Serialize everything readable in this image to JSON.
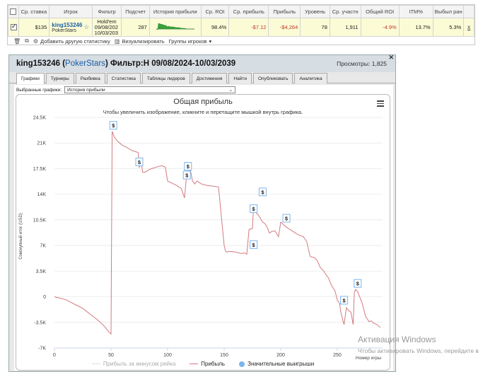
{
  "stats_table": {
    "headers": [
      "",
      "Ср. ставка",
      "Игрок",
      "Фильтр",
      "Подсчет",
      "История прибыли",
      "Ср. ROI",
      "Ср. прибыль",
      "Прибыль",
      "Уровень",
      "Ср. участн",
      "Общий ROI",
      "ITM%",
      "Выбыл ран",
      ""
    ],
    "row": {
      "avg_stake": "$135",
      "player_name": "king153246",
      "player_site": "PokerStars",
      "filter_line1": "Hold'em",
      "filter_line2": "09/08/202",
      "filter_line3": "10/03/203",
      "count": "287",
      "avg_roi": "98.4%",
      "avg_profit": "-$7.12",
      "profit": "-$4,264",
      "level": "78",
      "avg_entrants": "1,911",
      "total_roi": "-4.9%",
      "itm": "13.7%",
      "early_out": "5.3%",
      "remove": "x"
    }
  },
  "toolbar": {
    "add_stat": "Добавить другую статистику",
    "visualize": "Визуализировать",
    "player_groups": "Группы игроков"
  },
  "popup": {
    "player": "king153246",
    "site": "PokerStars",
    "title_rest": "Фильтр:H 09/08/2024-10/03/2039",
    "views": "Просмотры: 1,825",
    "tabs": [
      "Графики",
      "Турниры",
      "Разбивка",
      "Статистика",
      "Таблицы лидеров",
      "Достижения",
      "Найти",
      "Опубликовать",
      "Аналитика"
    ],
    "select_label": "Выбранные графики:",
    "select_value": "История прибыли"
  },
  "chart_data": {
    "type": "line",
    "title": "Общая прибыль",
    "subtitle": "Чтобы увеличить изображение, кликните и перетащите мышкой внутрь графика.",
    "ylabel": "Совокупный итог (USD)",
    "xlabel": "Номер игры",
    "ylim": [
      -7000,
      24500
    ],
    "xlim": [
      0,
      290
    ],
    "yticks": [
      24500,
      21000,
      17500,
      14000,
      10500,
      7000,
      3500,
      0,
      -3500,
      -7000
    ],
    "ytick_labels": [
      "24.5K",
      "21K",
      "17.5K",
      "14K",
      "10.5K",
      "7K",
      "3.5K",
      "0",
      "-3.5K",
      "-7K"
    ],
    "xticks": [
      0,
      50,
      100,
      150,
      200,
      250
    ],
    "grid": true,
    "legend": [
      "Прибыль за минусом рейка",
      "Прибыль",
      "Значительные выигрыши"
    ],
    "series": [
      {
        "name": "Прибыль",
        "color": "#d47a80",
        "x": [
          0,
          5,
          10,
          15,
          20,
          25,
          30,
          35,
          40,
          45,
          48,
          50,
          51,
          52,
          53,
          56,
          60,
          64,
          68,
          72,
          74,
          75,
          76,
          78,
          80,
          84,
          88,
          92,
          95,
          98,
          100,
          104,
          108,
          112,
          115,
          117,
          118,
          120,
          122,
          124,
          126,
          128,
          130,
          135,
          140,
          145,
          150,
          151,
          152,
          155,
          160,
          165,
          168,
          170,
          172,
          175,
          176,
          178,
          180,
          182,
          184,
          186,
          188,
          190,
          192,
          195,
          198,
          200,
          205,
          210,
          215,
          220,
          223,
          226,
          230,
          232,
          235,
          238,
          240,
          242,
          245,
          248,
          250,
          252,
          253,
          255,
          256,
          258,
          260,
          262,
          264,
          265,
          266,
          268,
          270,
          272,
          275,
          278,
          280,
          282,
          285,
          288
        ],
        "y": [
          0,
          -200,
          -400,
          -800,
          -1200,
          -1600,
          -2200,
          -2800,
          -3400,
          -4200,
          -4800,
          -5100,
          22600,
          22200,
          21800,
          21200,
          20700,
          20400,
          20000,
          19800,
          19700,
          17600,
          19000,
          17000,
          17000,
          17400,
          17600,
          17800,
          17900,
          17700,
          15800,
          15500,
          15200,
          14800,
          13500,
          17000,
          16800,
          17400,
          15800,
          15400,
          15800,
          15600,
          15400,
          15200,
          15100,
          15000,
          7000,
          6300,
          6100,
          6200,
          6100,
          5900,
          6000,
          5800,
          9200,
          9300,
          12500,
          11500,
          11200,
          10700,
          10200,
          10000,
          9500,
          8700,
          8900,
          9000,
          8200,
          10200,
          9500,
          9000,
          8500,
          8200,
          7500,
          5500,
          5300,
          5000,
          4000,
          3500,
          3000,
          2600,
          1500,
          800,
          -500,
          -900,
          -2000,
          -3300,
          -3800,
          -1500,
          -1900,
          -2100,
          -3800,
          500,
          1000,
          700,
          -100,
          -900,
          -2700,
          -3400,
          -3300,
          -3600,
          -3800,
          -4200
        ]
      }
    ],
    "markers": [
      {
        "x": 52,
        "y": 22600,
        "label": "$"
      },
      {
        "x": 75,
        "y": 17600,
        "label": "$"
      },
      {
        "x": 117,
        "y": 15800,
        "label": "$"
      },
      {
        "x": 118,
        "y": 17000,
        "label": "$"
      },
      {
        "x": 176,
        "y": 6300,
        "label": "$"
      },
      {
        "x": 176,
        "y": 11200,
        "label": "$"
      },
      {
        "x": 184,
        "y": 13500,
        "label": "$"
      },
      {
        "x": 205,
        "y": 9900,
        "label": "$"
      },
      {
        "x": 256,
        "y": -1300,
        "label": "$"
      },
      {
        "x": 268,
        "y": 1000,
        "label": "$"
      }
    ]
  },
  "watermark": {
    "line1": "Активация Windows",
    "line2": "Чтобы активировать Windows, перейдите в"
  }
}
